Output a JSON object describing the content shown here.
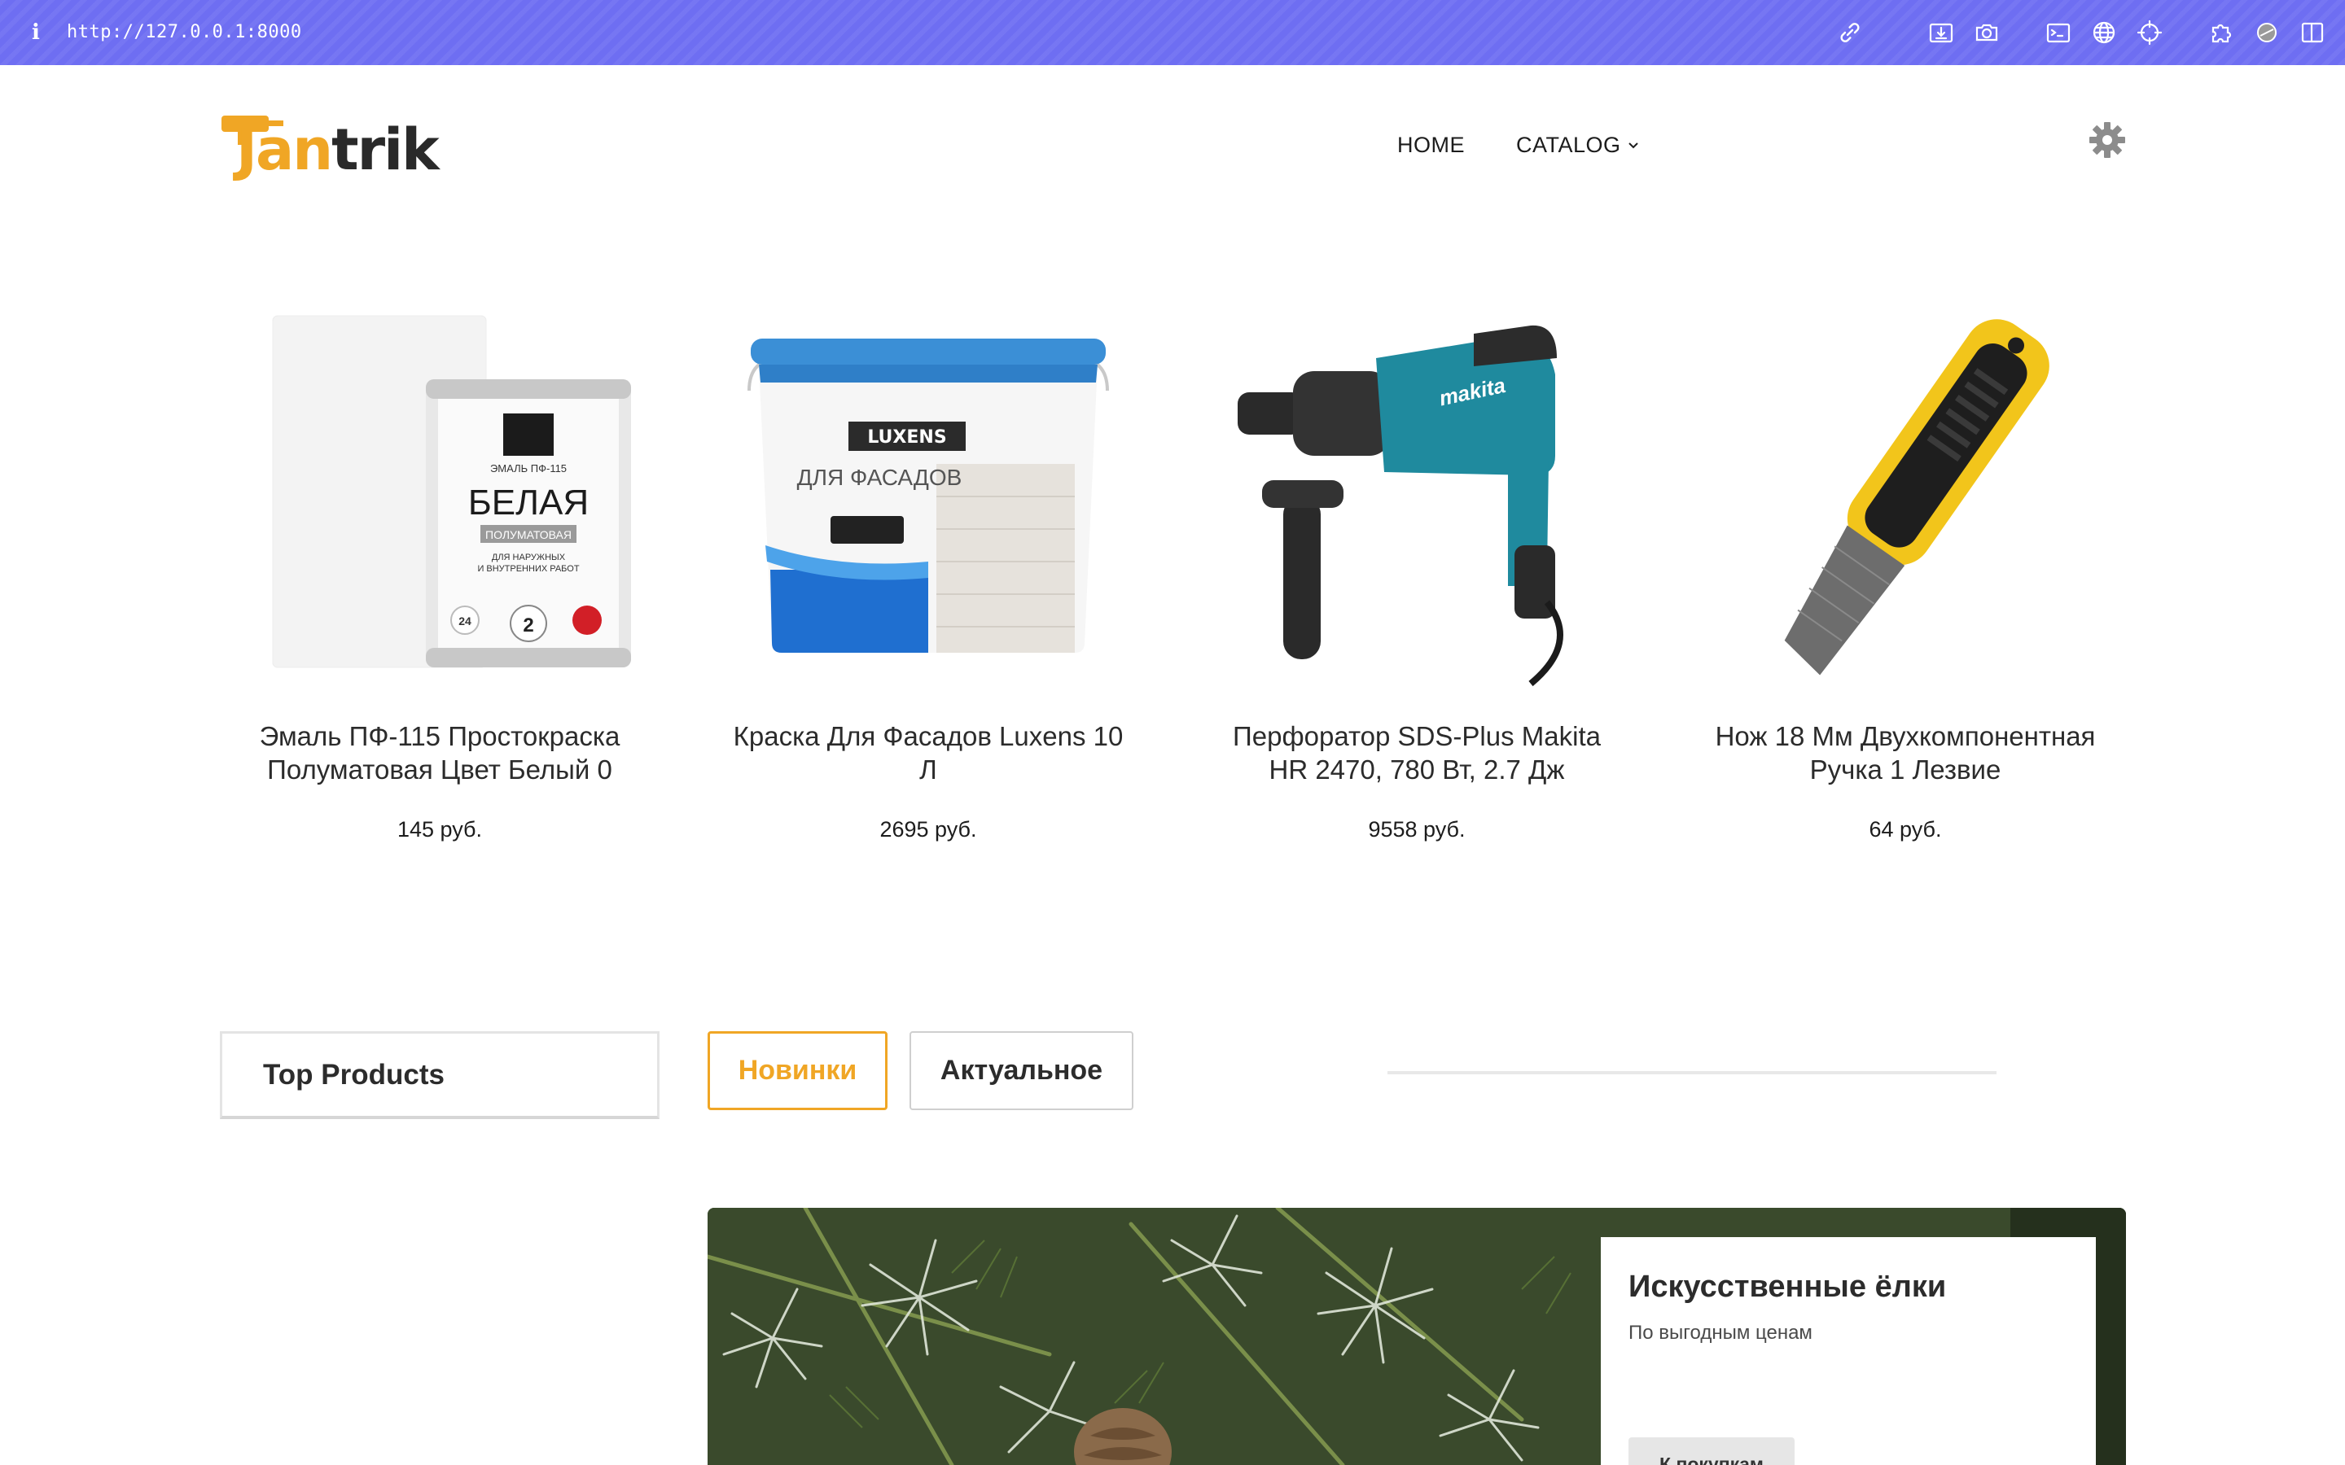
{
  "browser": {
    "info_glyph": "i",
    "url": "http://127.0.0.1:8000",
    "icons": [
      "link-icon",
      "download-icon",
      "camera-icon",
      "terminal-icon",
      "globe-icon",
      "crosshair-icon",
      "extension-icon",
      "toggle-icon",
      "sidebar-icon"
    ]
  },
  "header": {
    "logo_part1": "Jan",
    "logo_part2": "trik",
    "nav": [
      {
        "label": "HOME"
      },
      {
        "label": "CATALOG"
      }
    ],
    "settings_icon": "gear-icon"
  },
  "products": [
    {
      "name": "Эмаль ПФ-115 Простокраска Полуматовая Цвет Белый 0",
      "price": "145 руб.",
      "image_label_1": "БЕЛАЯ",
      "image_label_2": "ПОЛУМАТОВАЯ"
    },
    {
      "name": "Краска Для Фасадов Luxens 10 Л",
      "price": "2695 руб.",
      "image_label_1": "LUXENS",
      "image_label_2": "ДЛЯ ФАСАДОВ"
    },
    {
      "name": "Перфоратор SDS-Plus Makita HR 2470, 780 Вт, 2.7 Дж",
      "price": "9558 руб.",
      "image_label_1": "makita"
    },
    {
      "name": "Нож 18 Мм Двухкомпонентная Ручка 1 Лезвие",
      "price": "64 руб."
    }
  ],
  "tabs": {
    "sidebar_title": "Top Products",
    "items": [
      {
        "label": "Новинки",
        "active": true
      },
      {
        "label": "Актуальное",
        "active": false
      }
    ]
  },
  "banner": {
    "title": "Искусственные ёлки",
    "subtitle": "По выгодным ценам",
    "button": "К покупкам"
  },
  "colors": {
    "browser_bar": "#6e6ef2",
    "accent": "#f0a625",
    "text": "#2b2b2b"
  }
}
